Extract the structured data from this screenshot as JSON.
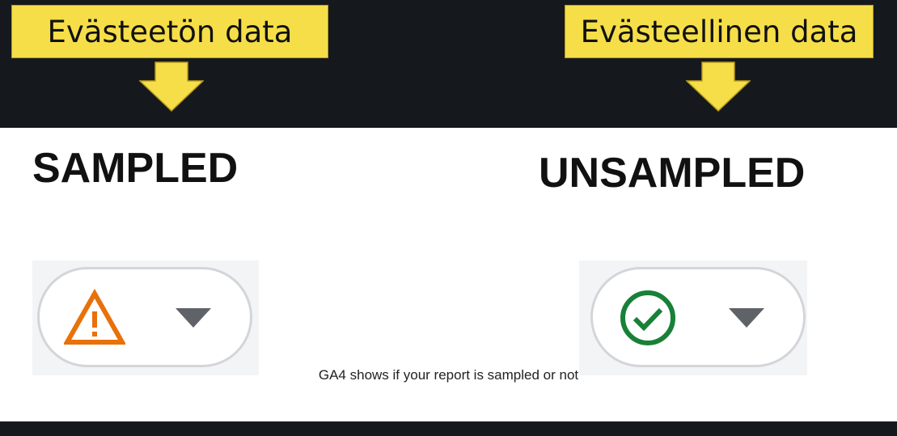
{
  "callouts": {
    "left": "Evästeetön data",
    "right": "Evästeellinen data",
    "color": "#f6de49"
  },
  "panel": {
    "left_title": "SAMPLED",
    "right_title": "UNSAMPLED",
    "left_chip": {
      "icon": "warning-triangle-icon",
      "icon_color": "#e8710a",
      "caret": "dropdown-caret-icon"
    },
    "right_chip": {
      "icon": "check-circle-icon",
      "icon_color": "#188038",
      "caret": "dropdown-caret-icon"
    },
    "caption": "GA4 shows if your report is sampled or not"
  }
}
